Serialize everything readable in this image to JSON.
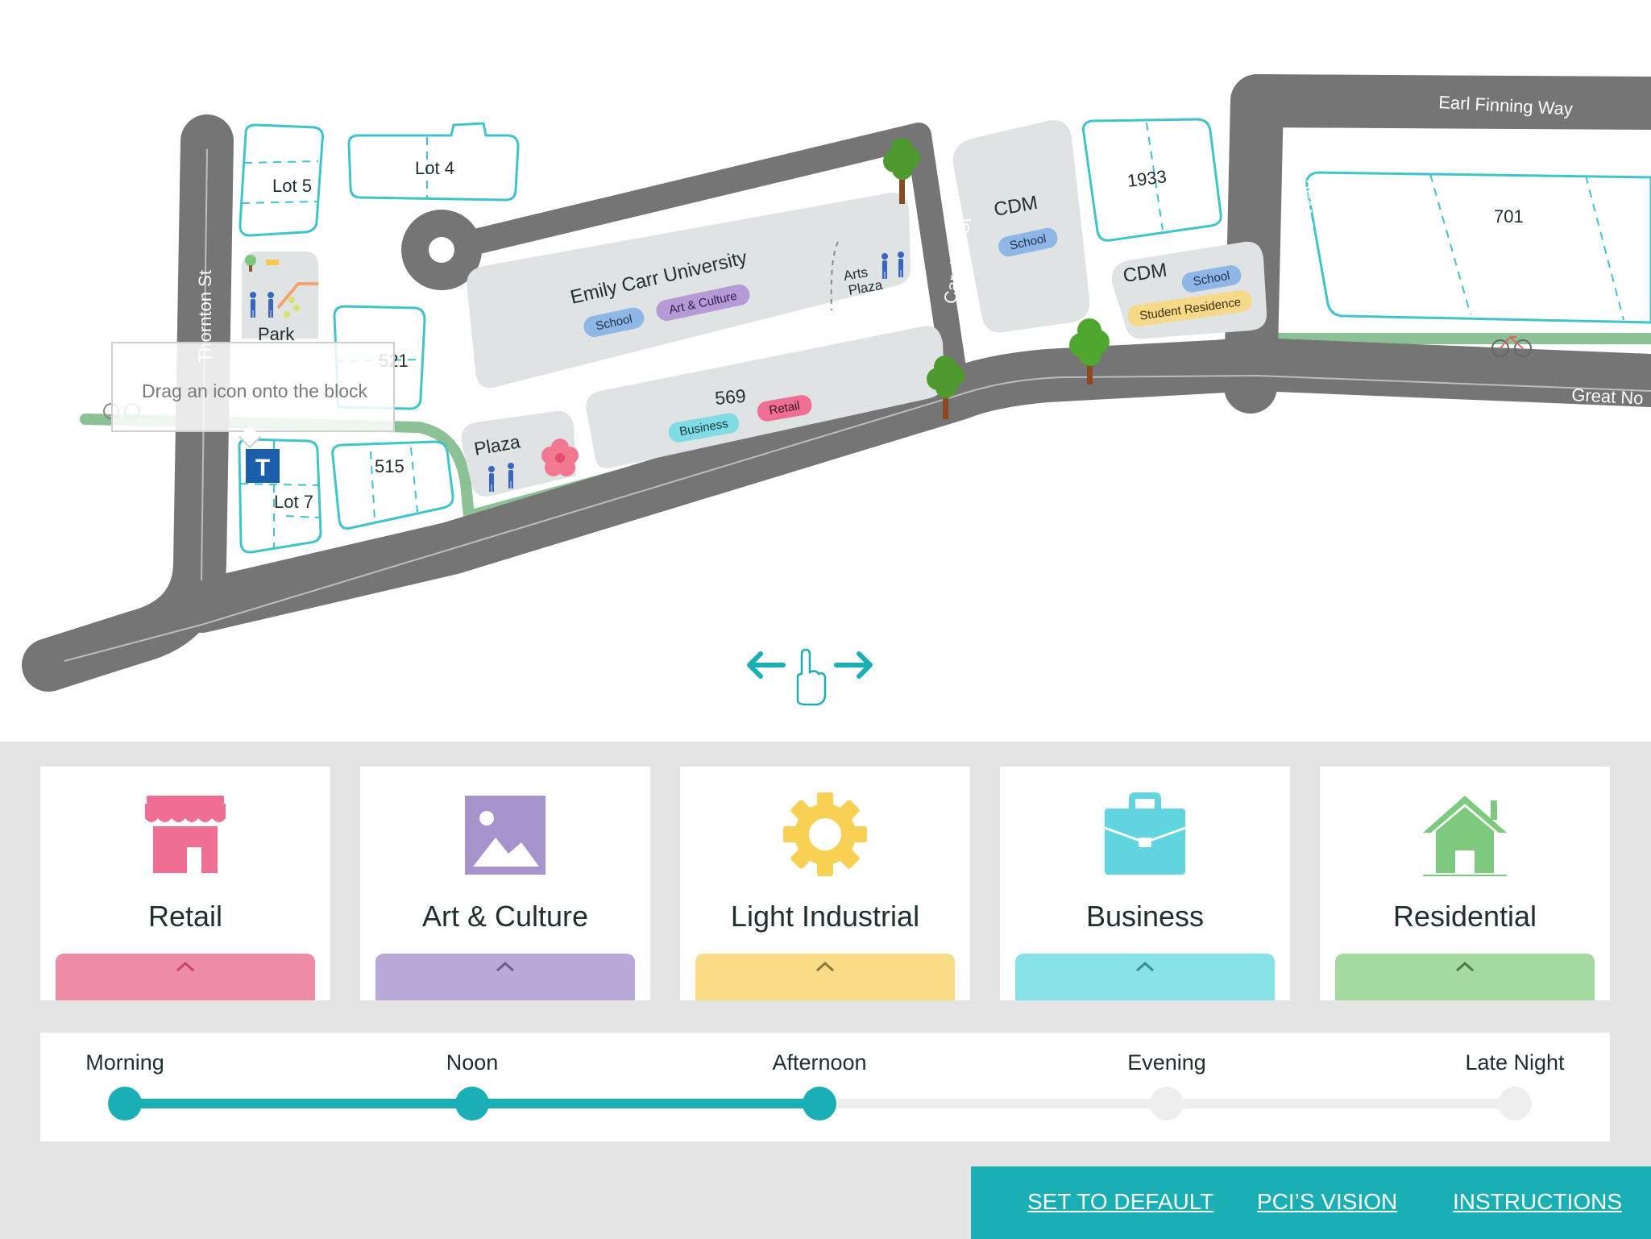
{
  "map": {
    "streets": {
      "thornton": "Thornton St",
      "carolina": "Carolina St",
      "earl_finning_vertical": "Earl Finning Way",
      "earl_finning_top": "Earl Finning Way",
      "great_northern": "Great Northern Way",
      "great_northern_right": "Great No"
    },
    "lots": {
      "lot5": "Lot 5",
      "lot4": "Lot 4",
      "park": "Park",
      "lot521": "521",
      "lot7": "Lot 7",
      "lot515": "515",
      "plaza": "Plaza",
      "ecu": "Emily Carr University",
      "arts_plaza_1": "Arts",
      "arts_plaza_2": "Plaza",
      "lot569": "569",
      "cdm_1": "CDM",
      "cdm_2": "CDM",
      "lot1933": "1933",
      "lot701": "701"
    },
    "tags": {
      "ecu_school": "School",
      "ecu_art": "Art & Culture",
      "b569_business": "Business",
      "b569_retail": "Retail",
      "cdm1_school": "School",
      "cdm2_school": "School",
      "cdm2_residence": "Student Residence"
    },
    "transit_icon_letter": "T",
    "tooltip": "Drag an icon onto the block"
  },
  "categories": [
    {
      "label": "Retail",
      "icon": "store-icon",
      "color": "#ee6f93",
      "tab_color": "#ee8ca6"
    },
    {
      "label": "Art & Culture",
      "icon": "image-icon",
      "color": "#a693cc",
      "tab_color": "#baa9d8"
    },
    {
      "label": "Light Industrial",
      "icon": "gear-icon",
      "color": "#f8d053",
      "tab_color": "#f9dc85"
    },
    {
      "label": "Business",
      "icon": "briefcase-icon",
      "color": "#60d5df",
      "tab_color": "#87e2e8"
    },
    {
      "label": "Residential",
      "icon": "house-icon",
      "color": "#7dca7f",
      "tab_color": "#a4d9a0"
    }
  ],
  "timeline": {
    "labels": [
      "Morning",
      "Noon",
      "Afternoon",
      "Evening",
      "Late Night"
    ],
    "selected_index": 2,
    "active_color": "#1aafb5",
    "inactive_color": "#eeeeee"
  },
  "footer": {
    "set_default": "SET TO DEFAULT",
    "vision": "PCI’S VISION",
    "instructions": "INSTRUCTIONS"
  }
}
